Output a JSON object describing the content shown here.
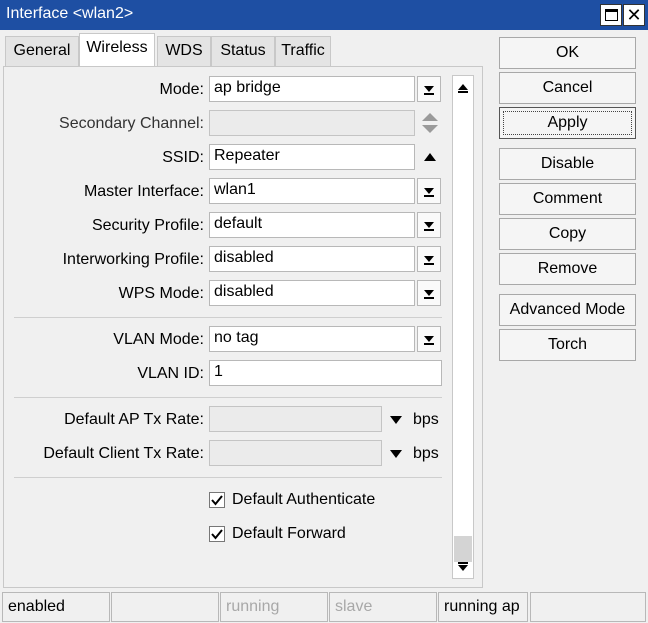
{
  "window": {
    "title": "Interface <wlan2>"
  },
  "tabs": [
    "General",
    "Wireless",
    "WDS",
    "Status",
    "Traffic"
  ],
  "form": {
    "mode": {
      "label": "Mode:",
      "value": "ap bridge"
    },
    "secondary_channel": {
      "label": "Secondary Channel:",
      "value": ""
    },
    "ssid": {
      "label": "SSID:",
      "value": "Repeater"
    },
    "master_interface": {
      "label": "Master Interface:",
      "value": "wlan1"
    },
    "security_profile": {
      "label": "Security Profile:",
      "value": "default"
    },
    "interworking_profile": {
      "label": "Interworking Profile:",
      "value": "disabled"
    },
    "wps_mode": {
      "label": "WPS Mode:",
      "value": "disabled"
    },
    "vlan_mode": {
      "label": "VLAN Mode:",
      "value": "no tag"
    },
    "vlan_id": {
      "label": "VLAN ID:",
      "value": "1"
    },
    "default_ap_tx_rate": {
      "label": "Default AP Tx Rate:",
      "value": "",
      "unit": "bps"
    },
    "default_client_tx_rate": {
      "label": "Default Client Tx Rate:",
      "value": "",
      "unit": "bps"
    },
    "default_authenticate": {
      "label": "Default Authenticate",
      "checked": true
    },
    "default_forward": {
      "label": "Default Forward",
      "checked": true
    }
  },
  "buttons": [
    "OK",
    "Cancel",
    "Apply",
    "Disable",
    "Comment",
    "Copy",
    "Remove",
    "Advanced Mode",
    "Torch"
  ],
  "status": [
    "enabled",
    "",
    "running",
    "slave",
    "running ap",
    ""
  ],
  "icons": {
    "dropdown": "dropdown-arrow-icon",
    "spinner": "spin-up-down-icon",
    "collapse": "triangle-up-icon",
    "select": "triangle-down-icon",
    "check": "checkmark-icon"
  },
  "colors": {
    "titlebar": "#1e4fa3",
    "panel": "#f0f0f0",
    "disabled_text": "#a8a8a8"
  }
}
